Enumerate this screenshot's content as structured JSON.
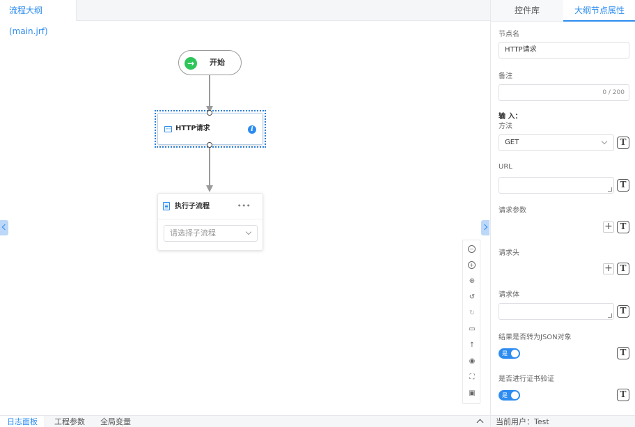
{
  "canvas": {
    "file_tab": "流程大纲(main.jrf)"
  },
  "nodes": {
    "start": {
      "label": "开始",
      "icon": "arrow-right-icon"
    },
    "http": {
      "label": "HTTP请求",
      "icon_text": "HTTP",
      "icon": "http-icon"
    },
    "subflow": {
      "label": "执行子流程",
      "more": "•••",
      "select_placeholder": "请选择子流程"
    }
  },
  "bottom_tabs": {
    "log": "日志面板",
    "params": "工程参数",
    "vars": "全局变量"
  },
  "right_panel": {
    "tabs": {
      "controls": "控件库",
      "props": "大纲节点属性"
    },
    "node_name_label": "节点名",
    "node_name_value": "HTTP请求",
    "remark_label": "备注",
    "remark_counter": "0 / 200",
    "input_section": "输 入：",
    "method_label": "方法",
    "method_value": "GET",
    "url_label": "URL",
    "query_label": "请求参数",
    "headers_label": "请求头",
    "body_label": "请求体",
    "json_label": "结果是否转为JSON对象",
    "json_toggle": "是",
    "cert_label": "是否进行证书验证",
    "cert_toggle": "是",
    "t_button": "T",
    "plus": "+",
    "current_user": "当前用户：Test"
  },
  "colors": {
    "accent": "#2d8cf0",
    "start_green": "#2ec55a",
    "edge_gray": "#9a9a9a"
  }
}
